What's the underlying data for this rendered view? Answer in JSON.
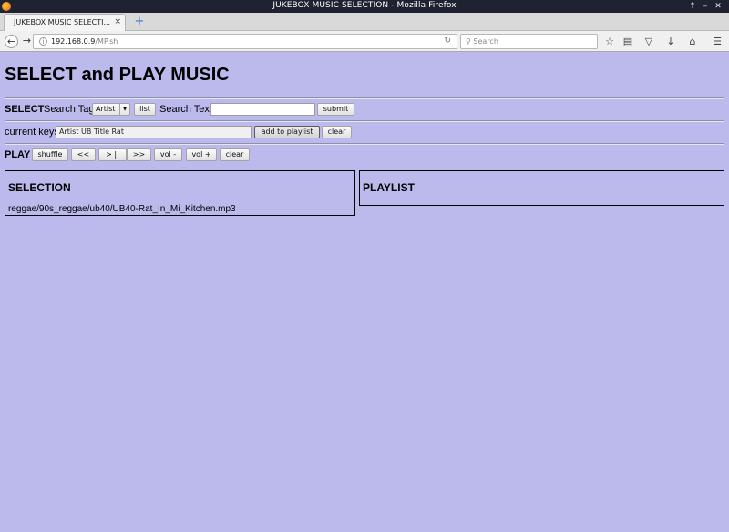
{
  "window": {
    "title": "JUKEBOX MUSIC SELECTION - Mozilla Firefox",
    "controls": [
      "↑",
      "–",
      "✕"
    ]
  },
  "tab": {
    "label": "JUKEBOX MUSIC SELECTI...",
    "close": "×"
  },
  "navbar": {
    "url_host": "192.168.0.9",
    "url_path": "/MP.sh",
    "search_placeholder": "Search"
  },
  "page": {
    "title": "SELECT and PLAY MUSIC",
    "select_row": {
      "label": "SELECT",
      "search_tag_label": "Search Tag",
      "search_tag_value": "Artist",
      "list_label": "list",
      "search_text_label": "Search Text",
      "search_text_value": "",
      "submit_label": "submit"
    },
    "keys_row": {
      "label": "current keys",
      "value": "Artist UB Title Rat",
      "add_label": "add to playlist",
      "clear_label": "clear"
    },
    "play_row": {
      "label": "PLAY",
      "buttons": [
        "shuffle",
        "<<",
        "> ||",
        ">>",
        "vol -",
        "vol +",
        "clear"
      ]
    },
    "selection": {
      "title": "SELECTION",
      "items": [
        "reggae/90s_reggae/ub40/UB40-Rat_In_Mi_Kitchen.mp3"
      ]
    },
    "playlist": {
      "title": "PLAYLIST",
      "items": []
    }
  }
}
